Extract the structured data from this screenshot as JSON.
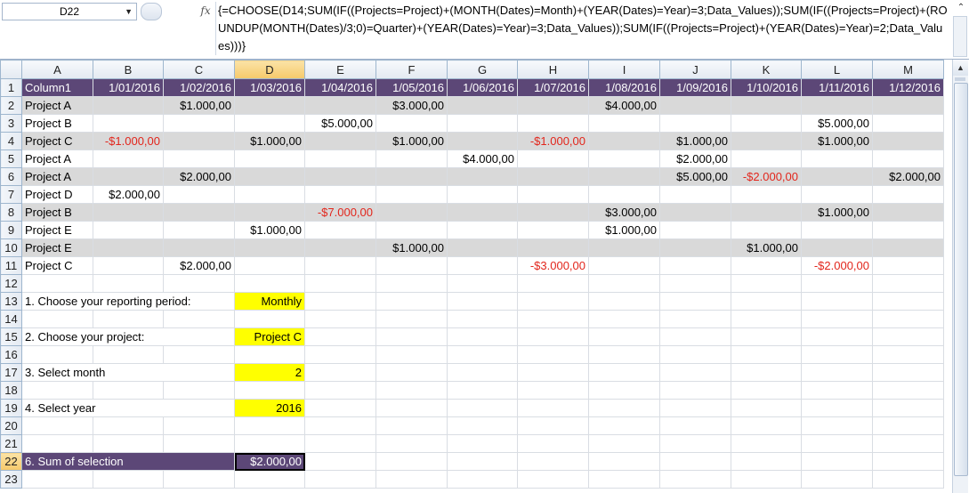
{
  "formula_bar": {
    "cell_reference": "D22",
    "fx_label": "fx",
    "formula": "{=CHOOSE(D14;SUM(IF((Projects=Project)+(MONTH(Dates)=Month)+(YEAR(Dates)=Year)=3;Data_Values));SUM(IF((Projects=Project)+(ROUNDUP(MONTH(Dates)/3;0)=Quarter)+(YEAR(Dates)=Year)=3;Data_Values));SUM(IF((Projects=Project)+(YEAR(Dates)=Year)=2;Data_Values)))}"
  },
  "columns": [
    "A",
    "B",
    "C",
    "D",
    "E",
    "F",
    "G",
    "H",
    "I",
    "J",
    "K",
    "L",
    "M"
  ],
  "selected_column": "D",
  "selected_row": "22",
  "header_row": {
    "row_number": "1",
    "cells": [
      "Column1",
      "1/01/2016",
      "1/02/2016",
      "1/03/2016",
      "1/04/2016",
      "1/05/2016",
      "1/06/2016",
      "1/07/2016",
      "1/08/2016",
      "1/09/2016",
      "1/10/2016",
      "1/11/2016",
      "1/12/2016"
    ]
  },
  "data_rows": [
    {
      "row": "2",
      "shaded": true,
      "cells": [
        "Project A",
        "",
        "$1.000,00",
        "",
        "",
        "$3.000,00",
        "",
        "",
        "$4.000,00",
        "",
        "",
        "",
        ""
      ]
    },
    {
      "row": "3",
      "shaded": false,
      "cells": [
        "Project B",
        "",
        "",
        "",
        "$5.000,00",
        "",
        "",
        "",
        "",
        "",
        "",
        "$5.000,00",
        ""
      ]
    },
    {
      "row": "4",
      "shaded": true,
      "cells": [
        "Project C",
        "-$1.000,00",
        "",
        "$1.000,00",
        "",
        "$1.000,00",
        "",
        "-$1.000,00",
        "",
        "$1.000,00",
        "",
        "$1.000,00",
        ""
      ]
    },
    {
      "row": "5",
      "shaded": false,
      "cells": [
        "Project A",
        "",
        "",
        "",
        "",
        "",
        "$4.000,00",
        "",
        "",
        "$2.000,00",
        "",
        "",
        ""
      ]
    },
    {
      "row": "6",
      "shaded": true,
      "cells": [
        "Project A",
        "",
        "$2.000,00",
        "",
        "",
        "",
        "",
        "",
        "",
        "$5.000,00",
        "-$2.000,00",
        "",
        "$2.000,00"
      ]
    },
    {
      "row": "7",
      "shaded": false,
      "cells": [
        "Project D",
        "$2.000,00",
        "",
        "",
        "",
        "",
        "",
        "",
        "",
        "",
        "",
        "",
        ""
      ]
    },
    {
      "row": "8",
      "shaded": true,
      "cells": [
        "Project B",
        "",
        "",
        "",
        "-$7.000,00",
        "",
        "",
        "",
        "$3.000,00",
        "",
        "",
        "$1.000,00",
        ""
      ]
    },
    {
      "row": "9",
      "shaded": false,
      "cells": [
        "Project E",
        "",
        "",
        "$1.000,00",
        "",
        "",
        "",
        "",
        "$1.000,00",
        "",
        "",
        "",
        ""
      ]
    },
    {
      "row": "10",
      "shaded": true,
      "cells": [
        "Project E",
        "",
        "",
        "",
        "",
        "$1.000,00",
        "",
        "",
        "",
        "",
        "$1.000,00",
        "",
        ""
      ]
    },
    {
      "row": "11",
      "shaded": false,
      "cells": [
        "Project C",
        "",
        "$2.000,00",
        "",
        "",
        "",
        "",
        "-$3.000,00",
        "",
        "",
        "",
        "-$2.000,00",
        ""
      ]
    }
  ],
  "controls": [
    {
      "row": "12",
      "label": "",
      "value": ""
    },
    {
      "row": "13",
      "label": "1. Choose your reporting period:",
      "value": "Monthly"
    },
    {
      "row": "14",
      "label": "",
      "value": ""
    },
    {
      "row": "15",
      "label": "2. Choose your project:",
      "value": "Project C"
    },
    {
      "row": "16",
      "label": "",
      "value": ""
    },
    {
      "row": "17",
      "label": "3. Select month",
      "value": "2"
    },
    {
      "row": "18",
      "label": "",
      "value": ""
    },
    {
      "row": "19",
      "label": "4. Select year",
      "value": "2016"
    },
    {
      "row": "20",
      "label": "",
      "value": ""
    },
    {
      "row": "21",
      "label": "",
      "value": ""
    }
  ],
  "sum_row": {
    "row": "22",
    "label": "6. Sum of selection",
    "value": "$2.000,00"
  },
  "trailing_row": {
    "row": "23"
  },
  "colors": {
    "header_purple": "#5c4777",
    "band_gray": "#d9d9d9",
    "input_yellow": "#ffff00",
    "negative_red": "#e2261c"
  }
}
